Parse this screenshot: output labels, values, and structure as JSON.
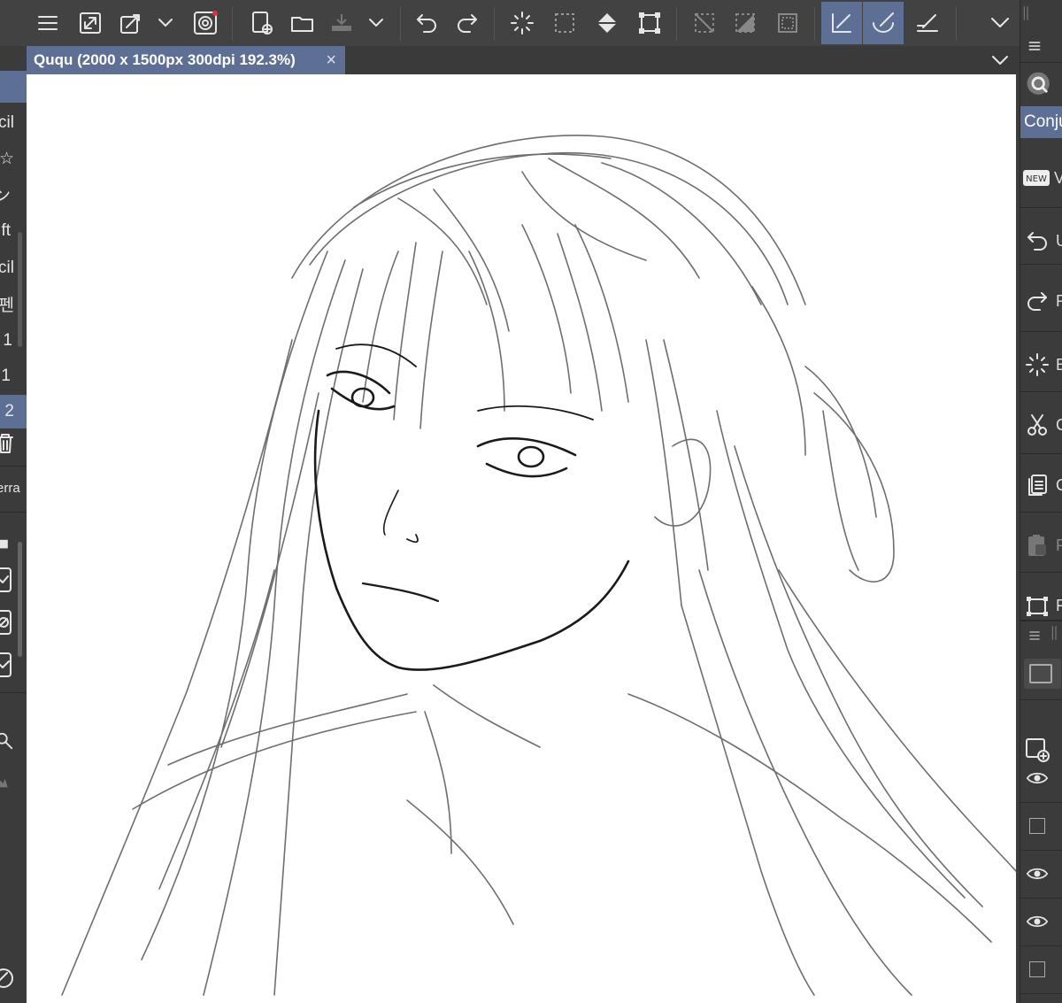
{
  "document_tab": {
    "title": "Ququ (2000 x 1500px 300dpi 192.3%)",
    "close_glyph": "×"
  },
  "toolbar": {
    "icons": [
      "menu-icon",
      "resize-icon",
      "transform-icon",
      "chevron-down-icon",
      "spiral-icon",
      "new-file-icon",
      "open-folder-icon",
      "save-icon",
      "chevron-down-icon",
      "undo-icon",
      "redo-icon",
      "select-all-icon",
      "deselect-icon",
      "fill-icon",
      "canvas-transform-icon",
      "hide-selection-icon",
      "invert-selection-icon",
      "selection-border-icon",
      "pen-pressure-icon",
      "blend-icon",
      "ruler-pen-icon",
      "chevron-down-icon"
    ],
    "active_color": "#5d6f94",
    "notification_dot_color": "#e03040"
  },
  "left_panel": {
    "items": [
      "cil",
      "☆",
      "ン",
      "ft",
      "cil",
      "펜",
      "1",
      "1",
      "2"
    ],
    "eraser_label": "erra",
    "highlight_index": 8
  },
  "right_panel": {
    "search_tab_label": "Conju",
    "menu_items": [
      {
        "icon": "new-badge-icon",
        "label": "V"
      },
      {
        "icon": "undo-icon",
        "label": "U"
      },
      {
        "icon": "redo-icon",
        "label": "R"
      },
      {
        "icon": "select-all-icon",
        "label": "E"
      },
      {
        "icon": "scissors-icon",
        "label": "C"
      },
      {
        "icon": "copy-icon",
        "label": "C"
      },
      {
        "icon": "paste-icon",
        "label": "P"
      },
      {
        "icon": "transform-icon",
        "label": "F"
      }
    ],
    "new_badge_text": "NEW"
  },
  "canvas": {
    "background": "#ffffff",
    "content": "pencil sketch of a figure with long hair"
  },
  "colors": {
    "panel": "#3b3b3b",
    "toolbar": "#424242",
    "accent": "#5d6f94"
  }
}
